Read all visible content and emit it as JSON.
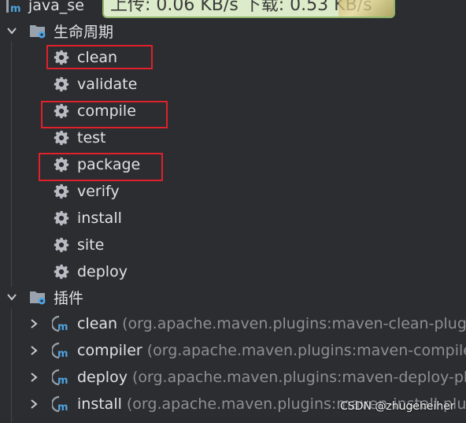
{
  "project": {
    "label": "java_se"
  },
  "banner": {
    "text": "上传: 0.06 KB/s 下载: 0.53 KB/s"
  },
  "lifecycle": {
    "label": "生命周期",
    "items": [
      {
        "label": "clean",
        "highlighted": true
      },
      {
        "label": "validate",
        "highlighted": false
      },
      {
        "label": "compile",
        "highlighted": true
      },
      {
        "label": "test",
        "highlighted": false
      },
      {
        "label": "package",
        "highlighted": true
      },
      {
        "label": "verify",
        "highlighted": false
      },
      {
        "label": "install",
        "highlighted": false
      },
      {
        "label": "site",
        "highlighted": false
      },
      {
        "label": "deploy",
        "highlighted": false
      }
    ]
  },
  "plugins": {
    "label": "插件",
    "items": [
      {
        "label": "clean",
        "detail": "(org.apache.maven.plugins:maven-clean-plugin"
      },
      {
        "label": "compiler",
        "detail": "(org.apache.maven.plugins:maven-compiler"
      },
      {
        "label": "deploy",
        "detail": "(org.apache.maven.plugins:maven-deploy-pl"
      },
      {
        "label": "install",
        "detail": "(org.apache.maven.plugins:maven-install-plug"
      }
    ]
  },
  "watermark": {
    "text": "CSDN @zhugeheiher"
  },
  "colors": {
    "highlight": "#e0202a",
    "background": "#2b2d30",
    "text": "#dfe1e5",
    "detail": "#8c8f94"
  }
}
